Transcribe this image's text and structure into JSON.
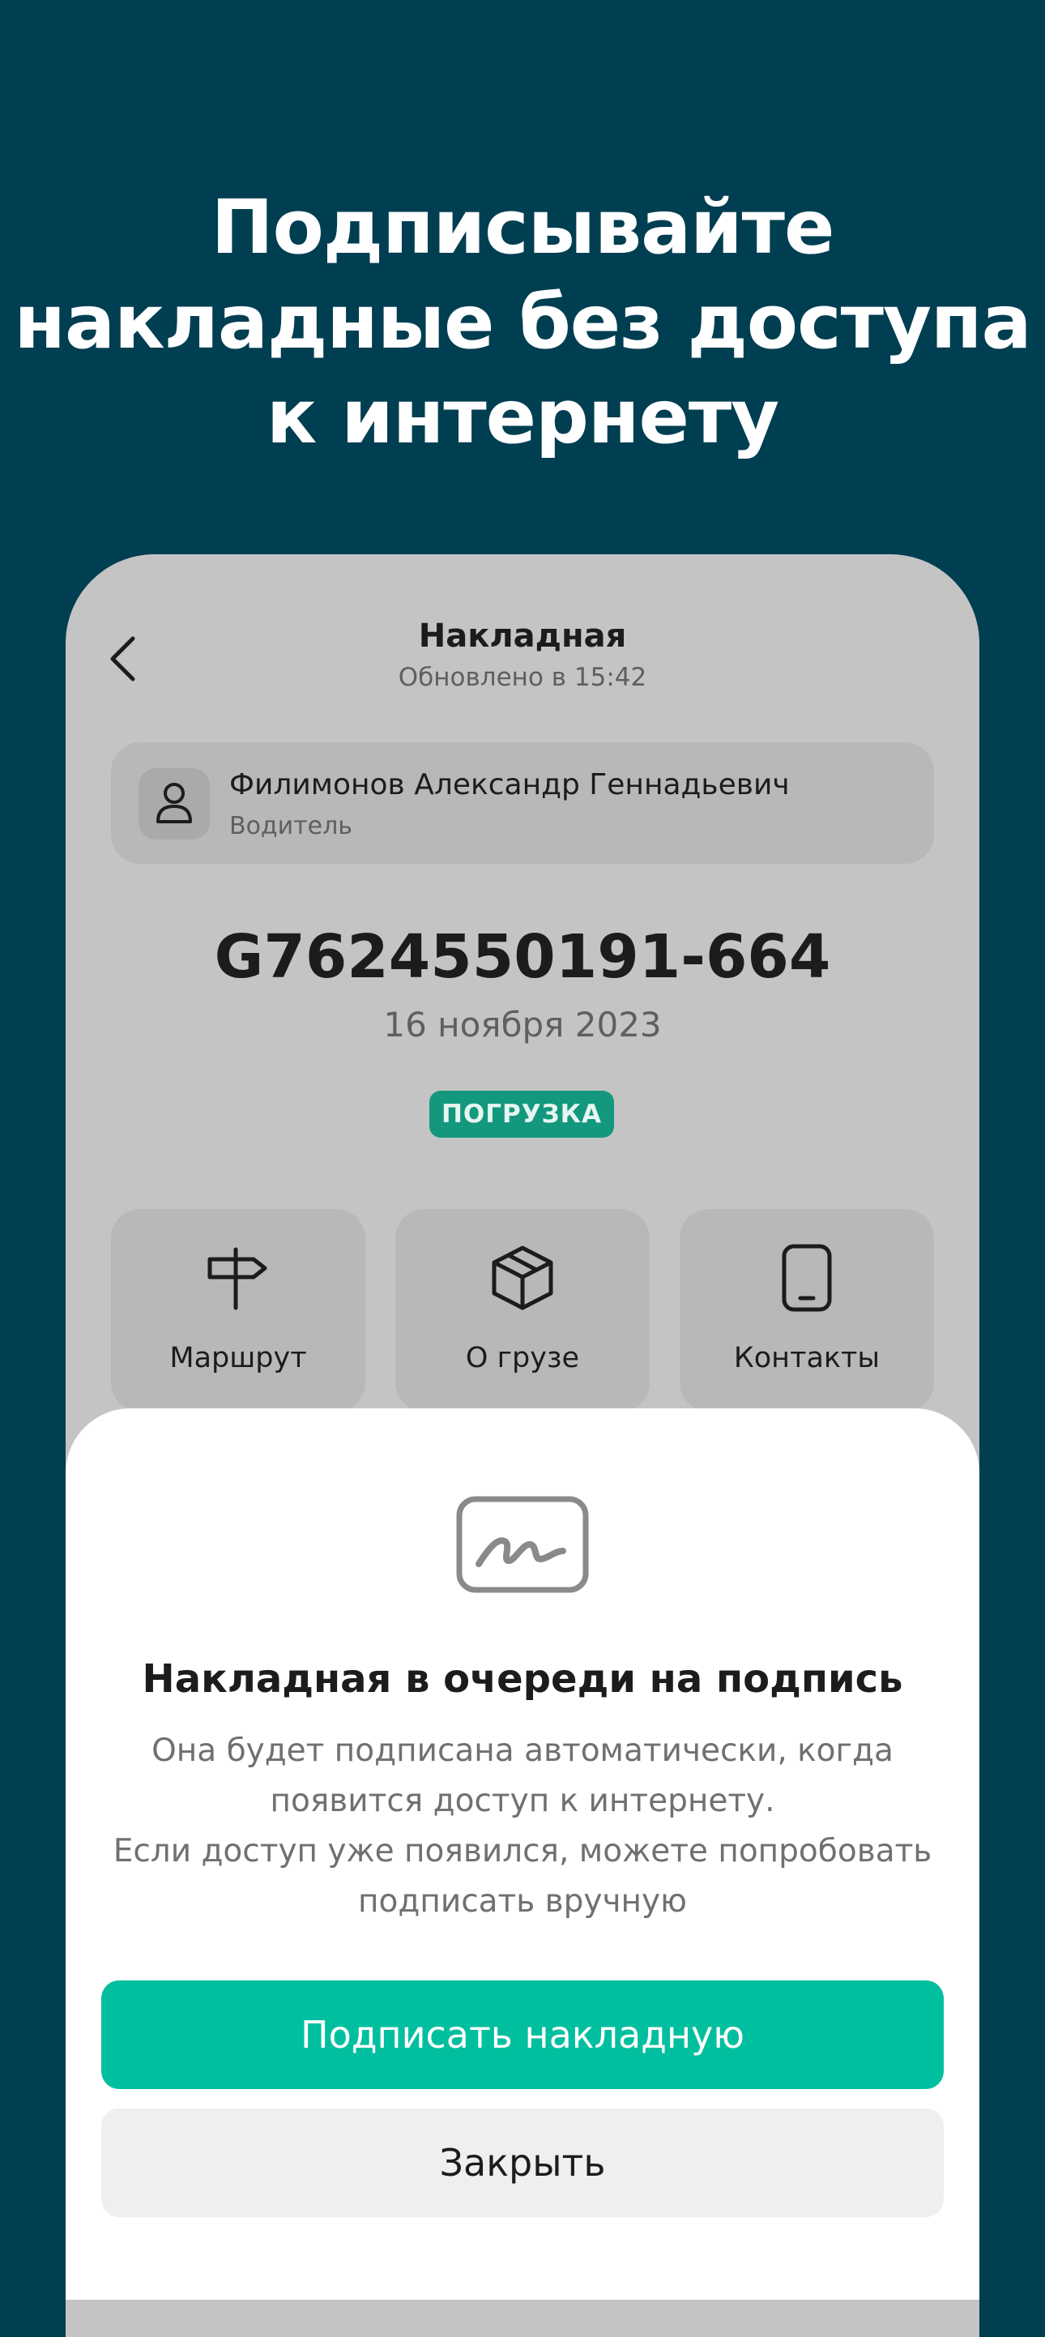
{
  "promo": {
    "title": "Подписывайте\nнакладные без доступа\nк интернету"
  },
  "header": {
    "title": "Накладная",
    "subtitle": "Обновлено в 15:42",
    "back_icon": "chevron-left-icon"
  },
  "driver": {
    "name": "Филимонов Александр Геннадьевич",
    "role": "Водитель",
    "icon": "person-icon"
  },
  "document": {
    "number": "G7624550191-664",
    "date": "16 ноября 2023",
    "status": "ПОГРУЗКА"
  },
  "actions": [
    {
      "label": "Маршрут",
      "icon": "signpost-icon"
    },
    {
      "label": "О грузе",
      "icon": "box-icon"
    },
    {
      "label": "Контакты",
      "icon": "phone-icon"
    }
  ],
  "sheet": {
    "icon": "signature-icon",
    "title": "Накладная в очереди на подпись",
    "description": "Она будет подписана автоматически, когда\nпоявится доступ к интернету.\nЕсли доступ уже появился, можете попробовать\nподписать вручную",
    "primary_button": "Подписать накладную",
    "secondary_button": "Закрыть"
  },
  "colors": {
    "background": "#003e52",
    "accent": "#00bf9f",
    "status_badge": "#13987d"
  }
}
